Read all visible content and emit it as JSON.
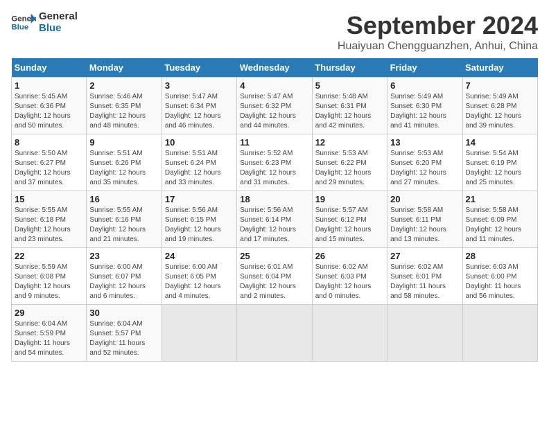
{
  "logo": {
    "line1": "General",
    "line2": "Blue"
  },
  "title": "September 2024",
  "subtitle": "Huaiyuan Chengguanzhen, Anhui, China",
  "days_of_week": [
    "Sunday",
    "Monday",
    "Tuesday",
    "Wednesday",
    "Thursday",
    "Friday",
    "Saturday"
  ],
  "weeks": [
    [
      {
        "day": "1",
        "sunrise": "Sunrise: 5:45 AM",
        "sunset": "Sunset: 6:36 PM",
        "daylight": "Daylight: 12 hours and 50 minutes."
      },
      {
        "day": "2",
        "sunrise": "Sunrise: 5:46 AM",
        "sunset": "Sunset: 6:35 PM",
        "daylight": "Daylight: 12 hours and 48 minutes."
      },
      {
        "day": "3",
        "sunrise": "Sunrise: 5:47 AM",
        "sunset": "Sunset: 6:34 PM",
        "daylight": "Daylight: 12 hours and 46 minutes."
      },
      {
        "day": "4",
        "sunrise": "Sunrise: 5:47 AM",
        "sunset": "Sunset: 6:32 PM",
        "daylight": "Daylight: 12 hours and 44 minutes."
      },
      {
        "day": "5",
        "sunrise": "Sunrise: 5:48 AM",
        "sunset": "Sunset: 6:31 PM",
        "daylight": "Daylight: 12 hours and 42 minutes."
      },
      {
        "day": "6",
        "sunrise": "Sunrise: 5:49 AM",
        "sunset": "Sunset: 6:30 PM",
        "daylight": "Daylight: 12 hours and 41 minutes."
      },
      {
        "day": "7",
        "sunrise": "Sunrise: 5:49 AM",
        "sunset": "Sunset: 6:28 PM",
        "daylight": "Daylight: 12 hours and 39 minutes."
      }
    ],
    [
      {
        "day": "8",
        "sunrise": "Sunrise: 5:50 AM",
        "sunset": "Sunset: 6:27 PM",
        "daylight": "Daylight: 12 hours and 37 minutes."
      },
      {
        "day": "9",
        "sunrise": "Sunrise: 5:51 AM",
        "sunset": "Sunset: 6:26 PM",
        "daylight": "Daylight: 12 hours and 35 minutes."
      },
      {
        "day": "10",
        "sunrise": "Sunrise: 5:51 AM",
        "sunset": "Sunset: 6:24 PM",
        "daylight": "Daylight: 12 hours and 33 minutes."
      },
      {
        "day": "11",
        "sunrise": "Sunrise: 5:52 AM",
        "sunset": "Sunset: 6:23 PM",
        "daylight": "Daylight: 12 hours and 31 minutes."
      },
      {
        "day": "12",
        "sunrise": "Sunrise: 5:53 AM",
        "sunset": "Sunset: 6:22 PM",
        "daylight": "Daylight: 12 hours and 29 minutes."
      },
      {
        "day": "13",
        "sunrise": "Sunrise: 5:53 AM",
        "sunset": "Sunset: 6:20 PM",
        "daylight": "Daylight: 12 hours and 27 minutes."
      },
      {
        "day": "14",
        "sunrise": "Sunrise: 5:54 AM",
        "sunset": "Sunset: 6:19 PM",
        "daylight": "Daylight: 12 hours and 25 minutes."
      }
    ],
    [
      {
        "day": "15",
        "sunrise": "Sunrise: 5:55 AM",
        "sunset": "Sunset: 6:18 PM",
        "daylight": "Daylight: 12 hours and 23 minutes."
      },
      {
        "day": "16",
        "sunrise": "Sunrise: 5:55 AM",
        "sunset": "Sunset: 6:16 PM",
        "daylight": "Daylight: 12 hours and 21 minutes."
      },
      {
        "day": "17",
        "sunrise": "Sunrise: 5:56 AM",
        "sunset": "Sunset: 6:15 PM",
        "daylight": "Daylight: 12 hours and 19 minutes."
      },
      {
        "day": "18",
        "sunrise": "Sunrise: 5:56 AM",
        "sunset": "Sunset: 6:14 PM",
        "daylight": "Daylight: 12 hours and 17 minutes."
      },
      {
        "day": "19",
        "sunrise": "Sunrise: 5:57 AM",
        "sunset": "Sunset: 6:12 PM",
        "daylight": "Daylight: 12 hours and 15 minutes."
      },
      {
        "day": "20",
        "sunrise": "Sunrise: 5:58 AM",
        "sunset": "Sunset: 6:11 PM",
        "daylight": "Daylight: 12 hours and 13 minutes."
      },
      {
        "day": "21",
        "sunrise": "Sunrise: 5:58 AM",
        "sunset": "Sunset: 6:09 PM",
        "daylight": "Daylight: 12 hours and 11 minutes."
      }
    ],
    [
      {
        "day": "22",
        "sunrise": "Sunrise: 5:59 AM",
        "sunset": "Sunset: 6:08 PM",
        "daylight": "Daylight: 12 hours and 9 minutes."
      },
      {
        "day": "23",
        "sunrise": "Sunrise: 6:00 AM",
        "sunset": "Sunset: 6:07 PM",
        "daylight": "Daylight: 12 hours and 6 minutes."
      },
      {
        "day": "24",
        "sunrise": "Sunrise: 6:00 AM",
        "sunset": "Sunset: 6:05 PM",
        "daylight": "Daylight: 12 hours and 4 minutes."
      },
      {
        "day": "25",
        "sunrise": "Sunrise: 6:01 AM",
        "sunset": "Sunset: 6:04 PM",
        "daylight": "Daylight: 12 hours and 2 minutes."
      },
      {
        "day": "26",
        "sunrise": "Sunrise: 6:02 AM",
        "sunset": "Sunset: 6:03 PM",
        "daylight": "Daylight: 12 hours and 0 minutes."
      },
      {
        "day": "27",
        "sunrise": "Sunrise: 6:02 AM",
        "sunset": "Sunset: 6:01 PM",
        "daylight": "Daylight: 11 hours and 58 minutes."
      },
      {
        "day": "28",
        "sunrise": "Sunrise: 6:03 AM",
        "sunset": "Sunset: 6:00 PM",
        "daylight": "Daylight: 11 hours and 56 minutes."
      }
    ],
    [
      {
        "day": "29",
        "sunrise": "Sunrise: 6:04 AM",
        "sunset": "Sunset: 5:59 PM",
        "daylight": "Daylight: 11 hours and 54 minutes."
      },
      {
        "day": "30",
        "sunrise": "Sunrise: 6:04 AM",
        "sunset": "Sunset: 5:57 PM",
        "daylight": "Daylight: 11 hours and 52 minutes."
      },
      null,
      null,
      null,
      null,
      null
    ]
  ]
}
